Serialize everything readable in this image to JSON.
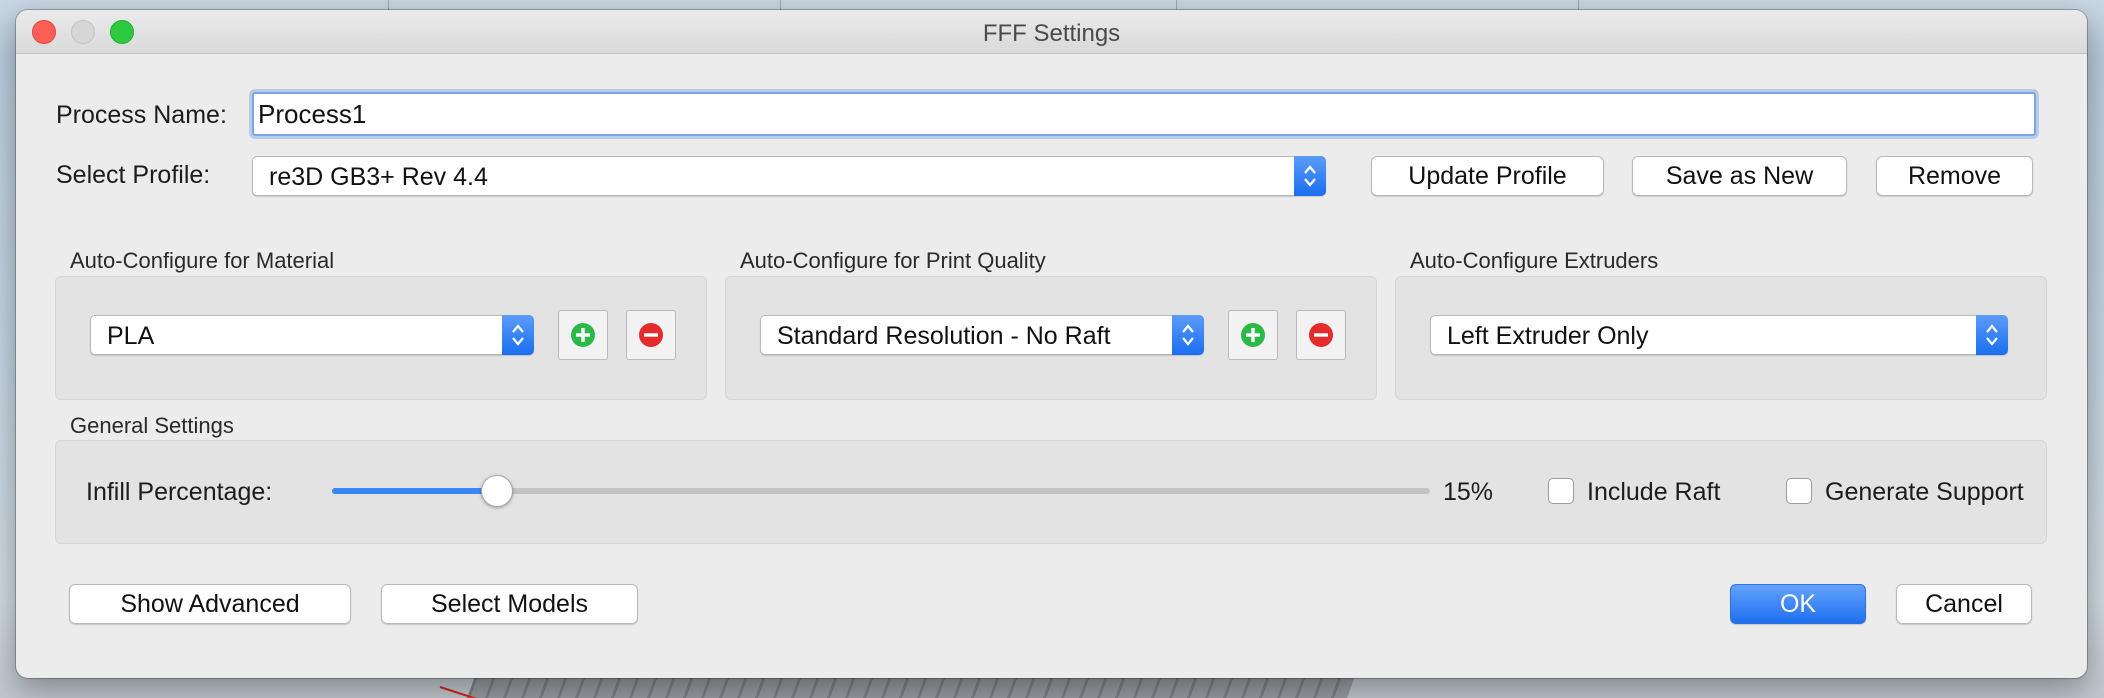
{
  "window": {
    "title": "FFF Settings"
  },
  "process": {
    "label": "Process Name:",
    "value": "Process1"
  },
  "profile": {
    "label": "Select Profile:",
    "selected": "re3D GB3+ Rev 4.4",
    "update_label": "Update Profile",
    "save_new_label": "Save as New",
    "remove_label": "Remove"
  },
  "material": {
    "label": "Auto-Configure for Material",
    "selected": "PLA"
  },
  "quality": {
    "label": "Auto-Configure for Print Quality",
    "selected": "Standard Resolution - No Raft"
  },
  "extruders": {
    "label": "Auto-Configure Extruders",
    "selected": "Left Extruder Only"
  },
  "general": {
    "label": "General Settings",
    "infill_label": "Infill Percentage:",
    "infill_value": 15,
    "infill_text": "15%",
    "include_raft_label": "Include Raft",
    "include_raft_checked": false,
    "generate_support_label": "Generate Support",
    "generate_support_checked": false
  },
  "footer": {
    "show_advanced_label": "Show Advanced",
    "select_models_label": "Select Models",
    "ok_label": "OK",
    "cancel_label": "Cancel"
  },
  "colors": {
    "accent": "#1f6ff0",
    "add_icon": "#2db84a",
    "remove_icon": "#e52b2b",
    "close": "#fd5f57",
    "zoom": "#2dc941"
  },
  "icons": {
    "add": "plus-circle-icon",
    "remove": "minus-circle-icon",
    "stepper": "chevron-up-down-icon"
  }
}
